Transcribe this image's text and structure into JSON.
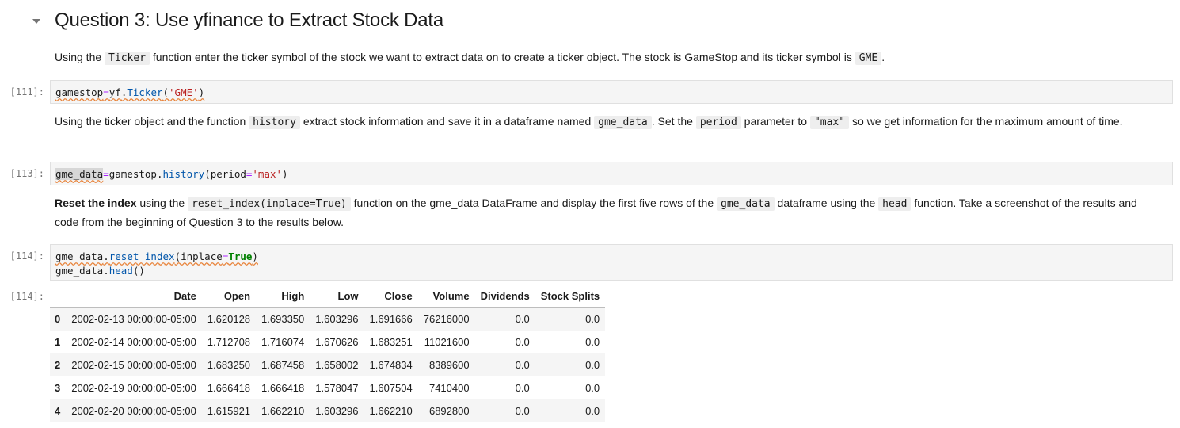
{
  "heading": "Question 3: Use yfinance to Extract Stock Data",
  "md1": {
    "t1": "Using the ",
    "c1": "Ticker",
    "t2": " function enter the ticker symbol of the stock we want to extract data on to create a ticker object. The stock is GameStop and its ticker symbol is ",
    "c2": "GME",
    "t3": "."
  },
  "cell111": {
    "prompt": "[111]:",
    "code": [
      "gamestop",
      "=",
      "yf",
      ".",
      "Ticker",
      "(",
      "'GME'",
      ")"
    ]
  },
  "md2": {
    "t1": "Using the ticker object and the function ",
    "c1": "history",
    "t2": " extract stock information and save it in a dataframe named ",
    "c2": "gme_data",
    "t3": ". Set the ",
    "c3": "period",
    "t4": " parameter to ",
    "c4": "\"max\"",
    "t5": " so we get information for the maximum amount of time."
  },
  "cell113": {
    "prompt": "[113]:",
    "code": [
      "gme_data",
      "=",
      "gamestop",
      ".",
      "history",
      "(",
      "period",
      "=",
      "'max'",
      ")"
    ]
  },
  "md3": {
    "b1": "Reset the index",
    "t1": " using the ",
    "c1": "reset_index(inplace=True)",
    "t2": " function on the gme_data DataFrame and display the first five rows of the ",
    "c2": "gme_data",
    "t3": " dataframe using the ",
    "c3": "head",
    "t4": " function. Take a screenshot of the results and code from the beginning of Question 3 to the results below."
  },
  "cell114": {
    "prompt": "[114]:",
    "line1": [
      "gme_data",
      ".",
      "reset_index",
      "(",
      "inplace",
      "=",
      "True",
      ")"
    ],
    "line2": [
      "gme_data",
      ".",
      "head",
      "()"
    ]
  },
  "output114": {
    "prompt": "[114]:",
    "columns": [
      "",
      "Date",
      "Open",
      "High",
      "Low",
      "Close",
      "Volume",
      "Dividends",
      "Stock Splits"
    ],
    "rows": [
      [
        "0",
        "2002-02-13 00:00:00-05:00",
        "1.620128",
        "1.693350",
        "1.603296",
        "1.691666",
        "76216000",
        "0.0",
        "0.0"
      ],
      [
        "1",
        "2002-02-14 00:00:00-05:00",
        "1.712708",
        "1.716074",
        "1.670626",
        "1.683251",
        "11021600",
        "0.0",
        "0.0"
      ],
      [
        "2",
        "2002-02-15 00:00:00-05:00",
        "1.683250",
        "1.687458",
        "1.658002",
        "1.674834",
        "8389600",
        "0.0",
        "0.0"
      ],
      [
        "3",
        "2002-02-19 00:00:00-05:00",
        "1.666418",
        "1.666418",
        "1.578047",
        "1.607504",
        "7410400",
        "0.0",
        "0.0"
      ],
      [
        "4",
        "2002-02-20 00:00:00-05:00",
        "1.615921",
        "1.662210",
        "1.603296",
        "1.662210",
        "6892800",
        "0.0",
        "0.0"
      ]
    ]
  }
}
